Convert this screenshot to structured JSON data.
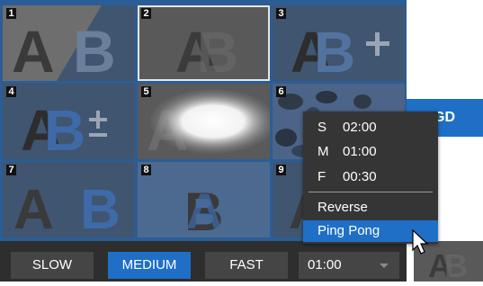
{
  "grid": {
    "cells": [
      {
        "number": "1",
        "icon": "ab-wipe-diagonal-icon"
      },
      {
        "number": "2",
        "icon": "ab-dissolve-icon"
      },
      {
        "number": "3",
        "icon": "ab-add-icon"
      },
      {
        "number": "4",
        "icon": "ab-plus-minus-icon"
      },
      {
        "number": "5",
        "icon": "ab-glow-icon"
      },
      {
        "number": "6",
        "icon": "camouflage-pattern-icon"
      },
      {
        "number": "7",
        "icon": "ab-split-icon"
      },
      {
        "number": "8",
        "icon": "ab-overlap-icon"
      },
      {
        "number": "9",
        "icon": "ab-partial-icon"
      }
    ],
    "selected": "2"
  },
  "side_button": {
    "label": "GD"
  },
  "speed_bar": {
    "slow_label": "SLOW",
    "medium_label": "MEDIUM",
    "fast_label": "FAST",
    "duration_value": "01:00",
    "active": "MEDIUM"
  },
  "duration_menu": {
    "presets": [
      {
        "key": "S",
        "time": "02:00"
      },
      {
        "key": "M",
        "time": "01:00"
      },
      {
        "key": "F",
        "time": "00:30"
      }
    ],
    "reverse_label": "Reverse",
    "ping_pong_label": "Ping Pong",
    "highlighted": "Ping Pong"
  },
  "colors": {
    "panel": "#2b5d97",
    "accent": "#1f6fc6",
    "cell_dark": "#4a4a4a",
    "cell_blue": "#3f5570",
    "menu_bg": "#353535"
  }
}
